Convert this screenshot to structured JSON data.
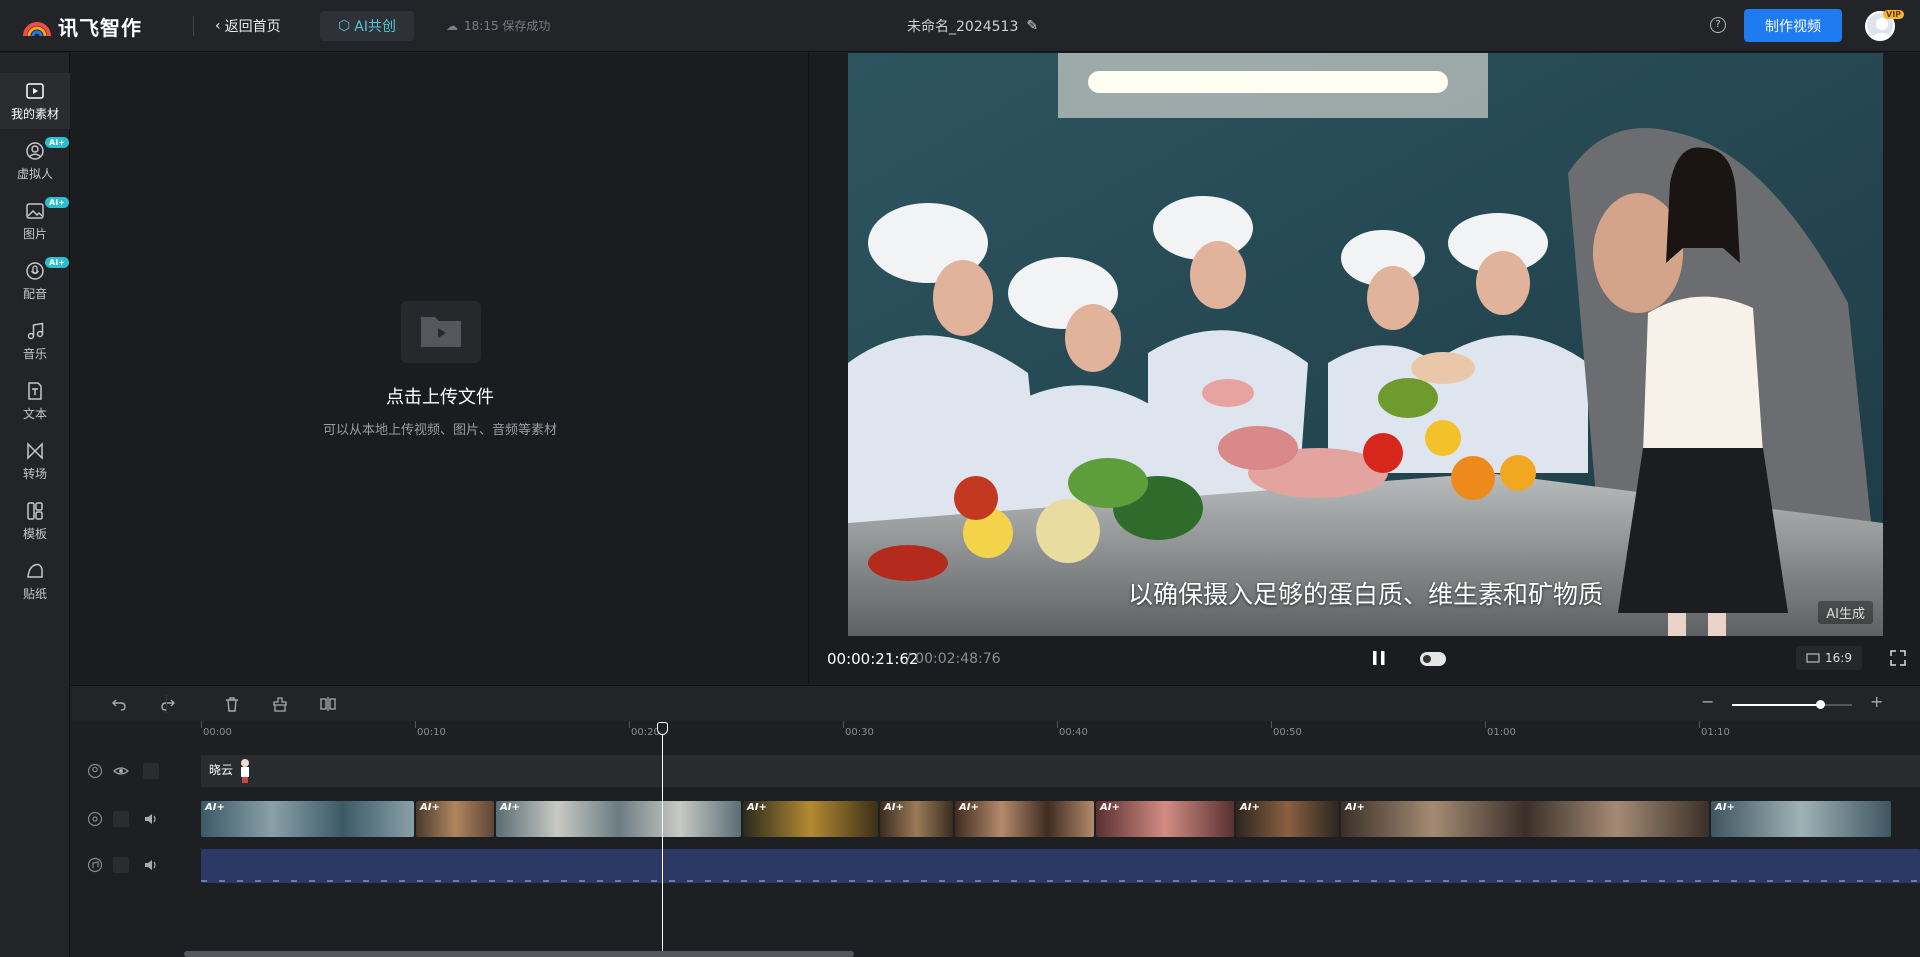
{
  "header": {
    "logo_text": "讯飞智作",
    "back_label": "返回首页",
    "ai_tab_label": "AI共创",
    "save_status": "18:15 保存成功",
    "doc_title": "未命名_2024513",
    "help_icon_label": "?",
    "make_video_label": "制作视频",
    "vip_badge": "VIP"
  },
  "sidebar": {
    "items": [
      {
        "label": "我的素材",
        "icon": "play-folder-icon",
        "active": true
      },
      {
        "label": "虚拟人",
        "icon": "avatar-icon",
        "badge": "AI+"
      },
      {
        "label": "图片",
        "icon": "image-icon",
        "badge": "AI+"
      },
      {
        "label": "配音",
        "icon": "voice-icon",
        "badge": "AI+"
      },
      {
        "label": "音乐",
        "icon": "music-icon"
      },
      {
        "label": "文本",
        "icon": "text-icon"
      },
      {
        "label": "转场",
        "icon": "transition-icon"
      },
      {
        "label": "模板",
        "icon": "template-icon"
      },
      {
        "label": "贴纸",
        "icon": "sticker-icon"
      }
    ]
  },
  "material": {
    "upload_title": "点击上传文件",
    "upload_subtitle": "可以从本地上传视频、图片、音频等素材"
  },
  "preview": {
    "subtitle": "以确保摄入足够的蛋白质、维生素和矿物质",
    "ai_generated_label": "AI生成",
    "current_time": "00:00:21:62",
    "total_time": "/ 00:02:48:76",
    "aspect_ratio": "16:9"
  },
  "timeline": {
    "ticks": [
      "00:00",
      "00:10",
      "00:20",
      "00:30",
      "00:40",
      "00:50",
      "01:00",
      "01:10"
    ],
    "avatar_track_name": "晓云",
    "clip_badge": "AI+",
    "zoom_minus": "−",
    "zoom_plus": "+",
    "zoom_level": 0.73
  },
  "colors": {
    "accent_blue": "#1f7cf0",
    "ai_cyan": "#4fc6d8",
    "audio_track": "#2c3866"
  }
}
